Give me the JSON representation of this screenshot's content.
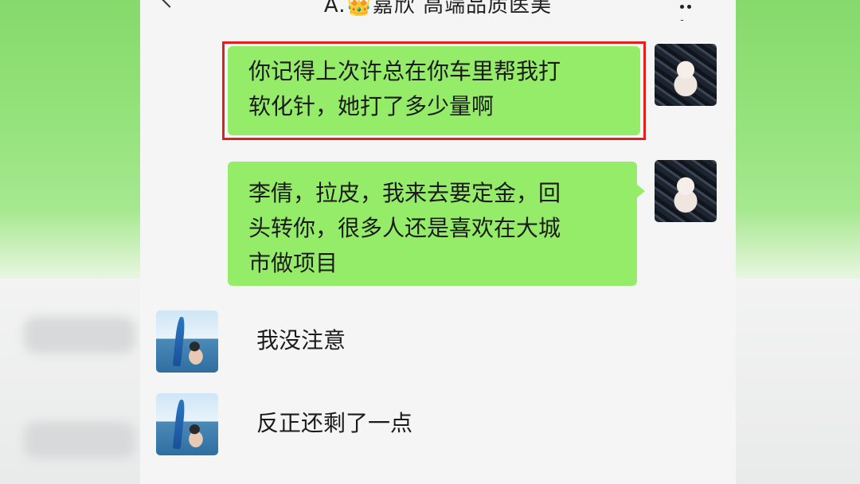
{
  "header": {
    "title": "A.👑嘉欣 高端品质医美"
  },
  "messages": [
    {
      "side": "right",
      "text_lines": [
        "你记得上次许总在你车里帮我打",
        "软化针，她打了多少量啊"
      ],
      "highlighted": true
    },
    {
      "side": "right",
      "text_lines": [
        "李倩，拉皮，我来去要定金，回",
        "头转你，很多人还是喜欢在大城",
        "市做项目"
      ],
      "highlighted": false
    },
    {
      "side": "left",
      "text_lines": [
        "我没注意"
      ],
      "highlighted": false
    },
    {
      "side": "left",
      "text_lines": [
        "反正还剩了一点"
      ],
      "highlighted": false
    }
  ],
  "colors": {
    "sent_bubble": "#95ec69",
    "highlight_border": "#e0201b",
    "chat_background": "#f5f5f5"
  },
  "icons": {
    "back": "chevron-left-icon",
    "more": "more-icon"
  }
}
